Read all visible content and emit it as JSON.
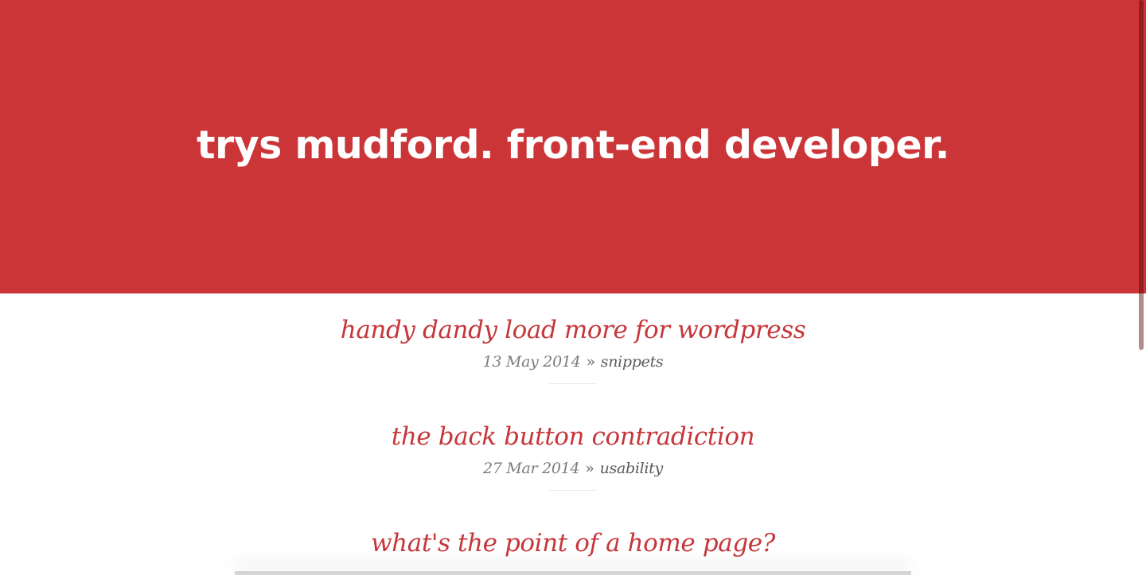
{
  "header": {
    "title": "trys mudford. front-end developer.",
    "background_color": "#cc3538"
  },
  "posts": [
    {
      "title": "handy dandy load more for wordpress",
      "date": "13 May 2014",
      "separator": "»",
      "category": "snippets"
    },
    {
      "title": "the back button contradiction",
      "date": "27 Mar 2014",
      "separator": "»",
      "category": "usability"
    },
    {
      "title": "what's the point of a home page?",
      "date": "",
      "separator": "",
      "category": ""
    }
  ],
  "colors": {
    "accent": "#c6363a",
    "meta": "#7c7c7c",
    "category": "#5a5a5a"
  }
}
